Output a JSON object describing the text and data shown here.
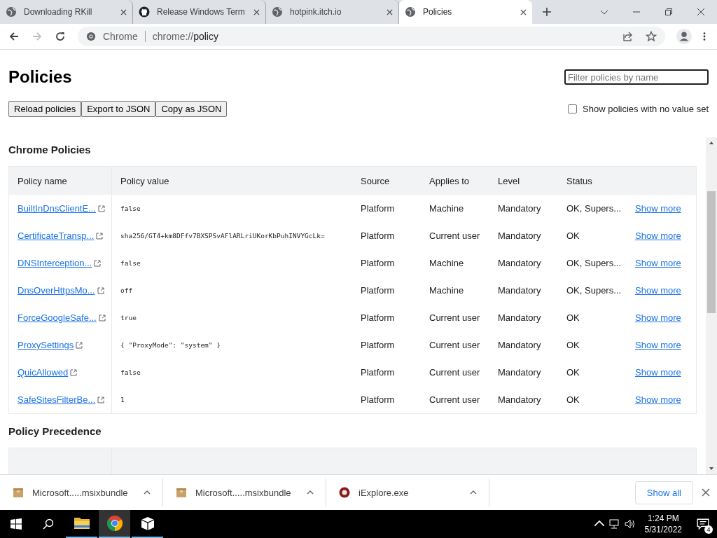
{
  "tabs": [
    {
      "title": "Downloading RKill",
      "kind": "globe",
      "selected": false
    },
    {
      "title": "Release Windows Term",
      "kind": "github",
      "selected": false
    },
    {
      "title": "hotpink.itch.io",
      "kind": "globe",
      "selected": false
    },
    {
      "title": "Policies",
      "kind": "globe",
      "selected": true
    }
  ],
  "address_bar": {
    "site_label": "Chrome",
    "url_scheme": "chrome://",
    "url_path": "policy"
  },
  "page": {
    "title": "Policies",
    "filter": {
      "placeholder": "Filter policies by name"
    },
    "buttons": [
      "Reload policies",
      "Export to JSON",
      "Copy as JSON"
    ],
    "show_unset": {
      "label": "Show policies with no value set",
      "checked": false
    },
    "sections": [
      {
        "title": "Chrome Policies",
        "columns": [
          "Policy name",
          "Policy value",
          "Source",
          "Applies to",
          "Level",
          "Status"
        ],
        "rows": [
          {
            "name": "BuiltInDnsClientE...",
            "value": "false",
            "source": "Platform",
            "applies_to": "Machine",
            "level": "Mandatory",
            "status": "OK, Supers...",
            "link": "Show more"
          },
          {
            "name": "CertificateTransp...",
            "value": "sha256/GT4+km8DFfv7BXSPSvAFlARLriUKorKbPuhINVYGcLk=",
            "source": "Platform",
            "applies_to": "Current user",
            "level": "Mandatory",
            "status": "OK",
            "link": "Show more"
          },
          {
            "name": "DNSInterception...",
            "value": "false",
            "source": "Platform",
            "applies_to": "Machine",
            "level": "Mandatory",
            "status": "OK, Supers...",
            "link": "Show more"
          },
          {
            "name": "DnsOverHttpsMo...",
            "value": "off",
            "source": "Platform",
            "applies_to": "Machine",
            "level": "Mandatory",
            "status": "OK, Supers...",
            "link": "Show more"
          },
          {
            "name": "ForceGoogleSafe...",
            "value": "true",
            "source": "Platform",
            "applies_to": "Current user",
            "level": "Mandatory",
            "status": "OK",
            "link": "Show more"
          },
          {
            "name": "ProxySettings",
            "value": "{ \"ProxyMode\": \"system\" }",
            "source": "Platform",
            "applies_to": "Current user",
            "level": "Mandatory",
            "status": "OK",
            "link": "Show more"
          },
          {
            "name": "QuicAllowed",
            "value": "false",
            "source": "Platform",
            "applies_to": "Current user",
            "level": "Mandatory",
            "status": "OK",
            "link": "Show more"
          },
          {
            "name": "SafeSitesFilterBe...",
            "value": "1",
            "source": "Platform",
            "applies_to": "Current user",
            "level": "Mandatory",
            "status": "OK",
            "link": "Show more"
          }
        ]
      },
      {
        "title": "Policy Precedence"
      }
    ]
  },
  "downloads": {
    "items": [
      {
        "name": "Microsoft.....msixbundle",
        "kind": "package"
      },
      {
        "name": "Microsoft.....msixbundle",
        "kind": "package"
      },
      {
        "name": "iExplore.exe",
        "kind": "exe"
      }
    ],
    "show_all": "Show all"
  },
  "taskbar": {
    "apps": [
      {
        "kind": "explorer",
        "selected": false
      },
      {
        "kind": "chrome",
        "selected": true
      },
      {
        "kind": "box",
        "selected": false
      }
    ],
    "time": "1:24 PM",
    "date": "5/31/2022",
    "notifications": "4"
  }
}
